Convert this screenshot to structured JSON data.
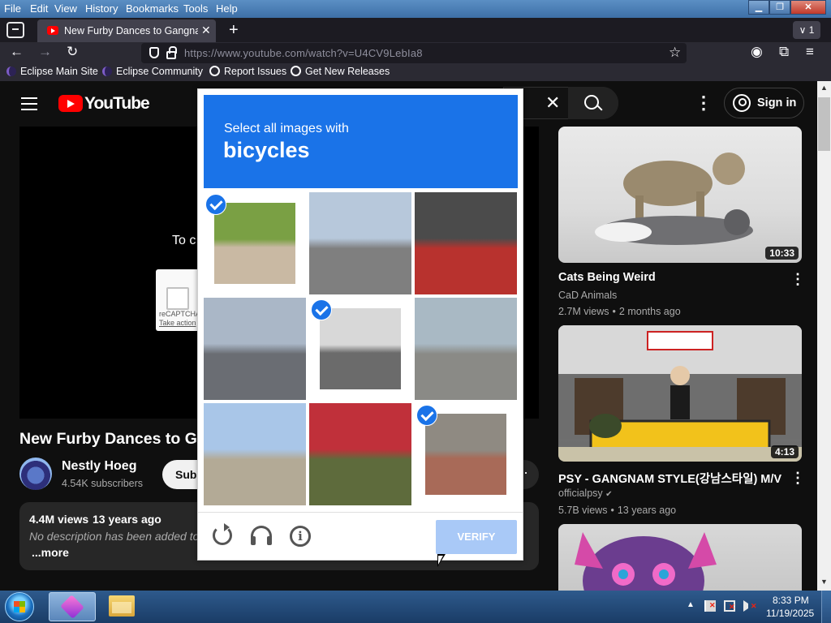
{
  "window": {
    "menus": [
      "File",
      "Edit",
      "View",
      "History",
      "Bookmarks",
      "Tools",
      "Help"
    ],
    "min_glyph": "▁",
    "max_glyph": "❐",
    "close_glyph": "✕"
  },
  "tabs": {
    "active_title": "New Furby Dances to Gangnam",
    "close_glyph": "✕",
    "new_tab_glyph": "+",
    "tab_count_label": "∨ 1"
  },
  "nav": {
    "back_glyph": "←",
    "forward_glyph": "→",
    "reload_glyph": "↻",
    "url": "https://www.youtube.com/watch?v=U4CV9LebIa8",
    "star_glyph": "☆",
    "account_glyph": "◉",
    "extensions_glyph": "⧉",
    "menu_glyph": "≡"
  },
  "bookmarks": [
    "Eclipse Main Site",
    "Eclipse Community",
    "Report Issues",
    "Get New Releases"
  ],
  "youtube": {
    "logo": "YouTube",
    "clear_glyph": "✕",
    "kebab_glyph": "⋮",
    "sign_in": "Sign in",
    "player_message": "To c",
    "recaptcha_label": "reCAPTCHA",
    "recaptcha_action": "Take action",
    "video_title": "New Furby Dances to Ga",
    "channel": "Nestly Hoeg",
    "subscribers": "4.54K subscribers",
    "subscribe": "Subscribe",
    "more_glyph": "⋯",
    "views": "4.4M views",
    "age": "13 years ago",
    "description": "No description has been added to",
    "more": "...more"
  },
  "recommended": [
    {
      "title": "Cats Being Weird",
      "channel": "CaD Animals",
      "views": "2.7M views",
      "age": "2 months ago",
      "duration": "10:33"
    },
    {
      "title": "PSY - GANGNAM STYLE(강남스타일) M/V",
      "channel": "officialpsy",
      "views": "5.7B views",
      "age": "13 years ago",
      "duration": "4:13",
      "verified_glyph": "✔"
    },
    {
      "title": "",
      "channel": "",
      "views": "",
      "age": "",
      "duration": ""
    }
  ],
  "captcha": {
    "instruction": "Select all images with",
    "target": "bicycles",
    "verify": "VERIFY",
    "info_glyph": "i",
    "tiles": [
      {
        "name": "tile-cyclist-field",
        "selected": true,
        "colors": [
          "#7aa044",
          "#c9b9a3"
        ]
      },
      {
        "name": "tile-building-street",
        "selected": false,
        "colors": [
          "#b7c8db",
          "#7f7f7f"
        ]
      },
      {
        "name": "tile-scooters",
        "selected": false,
        "colors": [
          "#4b4b4b",
          "#b8322e"
        ]
      },
      {
        "name": "tile-intersection",
        "selected": false,
        "colors": [
          "#aab7c7",
          "#6a6d73"
        ]
      },
      {
        "name": "tile-parked-bicycle",
        "selected": true,
        "colors": [
          "#d8d8d8",
          "#6b6b6b"
        ]
      },
      {
        "name": "tile-road-crosswalk",
        "selected": false,
        "colors": [
          "#a9b9c4",
          "#8a8a86"
        ]
      },
      {
        "name": "tile-harbor",
        "selected": false,
        "colors": [
          "#a9c6e8",
          "#b3aa96"
        ]
      },
      {
        "name": "tile-sign-shrub",
        "selected": false,
        "colors": [
          "#c0303a",
          "#5e6b3c"
        ]
      },
      {
        "name": "tile-red-bicycle",
        "selected": true,
        "colors": [
          "#8f8a82",
          "#a86a58"
        ]
      }
    ]
  },
  "taskbar": {
    "time": "8:33 PM",
    "date": "11/19/2025",
    "tray_up_glyph": "▲"
  },
  "scrollbar": {
    "up_glyph": "▲",
    "down_glyph": "▼"
  }
}
